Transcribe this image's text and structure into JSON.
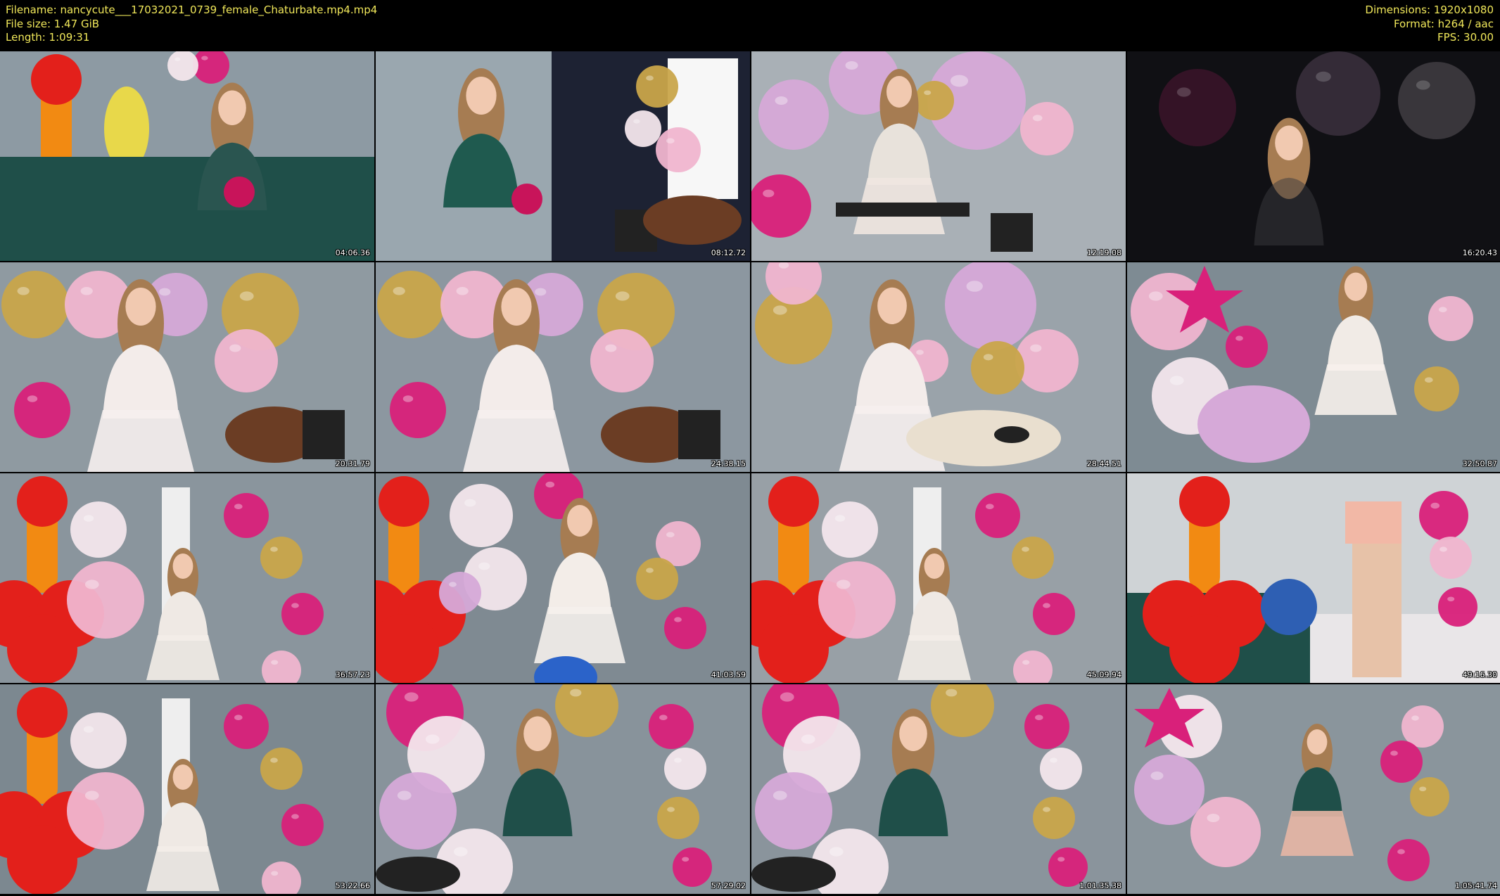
{
  "file": {
    "filename_line": "Filename: nancycute___17032021_0739_female_Chaturbate.mp4.mp4",
    "size_line": "File size: 1.47 GiB",
    "length_line": "Length: 1:09:31",
    "dimensions_line": "Dimensions: 1920x1080",
    "format_line": "Format: h264 / aac",
    "fps_line": "FPS: 30.00"
  },
  "colors": {
    "text": "#f1e85a",
    "background": "#000000"
  },
  "thumbnails": [
    {
      "timestamp": "04:06.36",
      "scene": "balloon-toys-rose",
      "bg": "#8d9aa3"
    },
    {
      "timestamp": "08:12.72",
      "scene": "green-top-rose",
      "bg": "#9aa7af"
    },
    {
      "timestamp": "12:19.08",
      "scene": "balloons-tablet",
      "bg": "#a9b0b6"
    },
    {
      "timestamp": "16:20.43",
      "scene": "dark-balloons",
      "bg": "#101014"
    },
    {
      "timestamp": "20:31.79",
      "scene": "balloons-cake",
      "bg": "#8f9aa1"
    },
    {
      "timestamp": "24:38.15",
      "scene": "balloons-cake",
      "bg": "#8c97a0"
    },
    {
      "timestamp": "28:44.51",
      "scene": "balloons-mouse",
      "bg": "#9aa3aa"
    },
    {
      "timestamp": "32:50.87",
      "scene": "balloons-stars",
      "bg": "#7e8b93"
    },
    {
      "timestamp": "36:57.23",
      "scene": "orange-balloon-figure",
      "bg": "#8a959d"
    },
    {
      "timestamp": "41:03.59",
      "scene": "balloons-dress-back",
      "bg": "#7f8a92"
    },
    {
      "timestamp": "45:09.94",
      "scene": "orange-balloon-figure",
      "bg": "#98a0a6"
    },
    {
      "timestamp": "49:16.30",
      "scene": "orange-balloon-shorts",
      "bg": "#cfd3d6"
    },
    {
      "timestamp": "53:22.66",
      "scene": "orange-balloon-figure",
      "bg": "#7c8890"
    },
    {
      "timestamp": "57:29.02",
      "scene": "balloons-lean",
      "bg": "#88939b"
    },
    {
      "timestamp": "1:01:35.38",
      "scene": "balloons-lean",
      "bg": "#8a949c"
    },
    {
      "timestamp": "1:05:41.74",
      "scene": "balloons-standing",
      "bg": "#8a959c"
    }
  ]
}
